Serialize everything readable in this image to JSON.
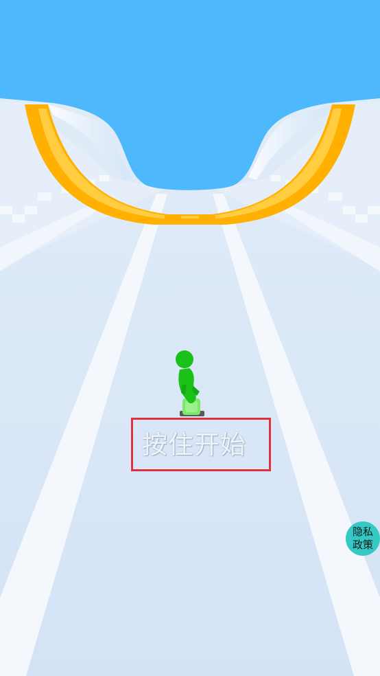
{
  "game": {
    "start_hint": "按住开始",
    "privacy_button": {
      "line1": "隐私",
      "line2": "政策"
    }
  },
  "colors": {
    "sky": "#4db8fb",
    "track": "#dce8f7",
    "track_stripe": "#f4f8fd",
    "ramp_orange": "#ffb000",
    "ramp_yellow": "#ffd24a",
    "character": "#19c119",
    "skateboard": "#7de86a",
    "highlight_box": "#e0323b",
    "privacy_button": "#36c8c4"
  },
  "icons": {
    "character": "stickman-character-icon",
    "skateboard": "skateboard-icon"
  }
}
